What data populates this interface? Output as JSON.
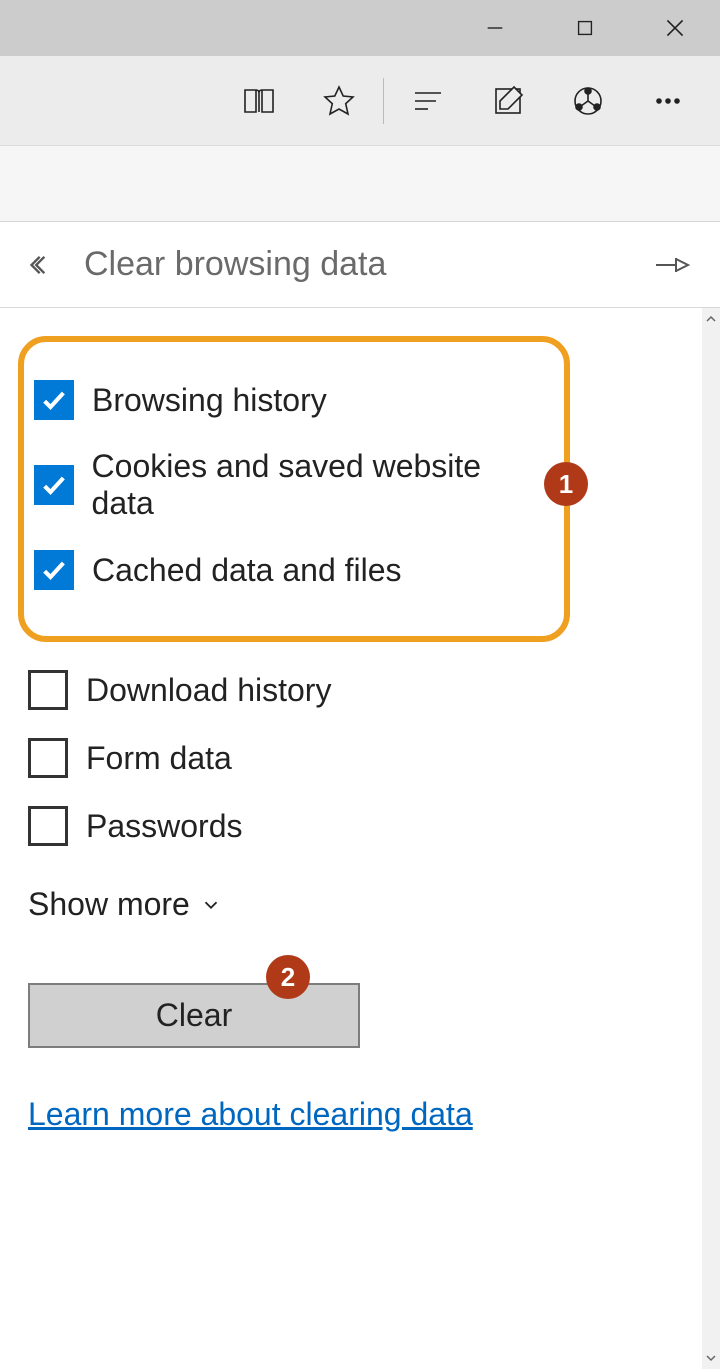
{
  "panel": {
    "title": "Clear browsing data",
    "show_more_label": "Show more",
    "clear_button_label": "Clear",
    "learn_more_label": "Learn more about clearing data"
  },
  "options": [
    {
      "label": "Browsing history",
      "checked": true
    },
    {
      "label": "Cookies and saved website data",
      "checked": true
    },
    {
      "label": "Cached data and files",
      "checked": true
    },
    {
      "label": "Download history",
      "checked": false
    },
    {
      "label": "Form data",
      "checked": false
    },
    {
      "label": "Passwords",
      "checked": false
    }
  ],
  "annotations": {
    "highlight_callout": "1",
    "clear_callout": "2"
  },
  "colors": {
    "checkbox_checked": "#0179d6",
    "highlight_border": "#f0a020",
    "callout_bg": "#b03a18",
    "link": "#0067c0"
  }
}
